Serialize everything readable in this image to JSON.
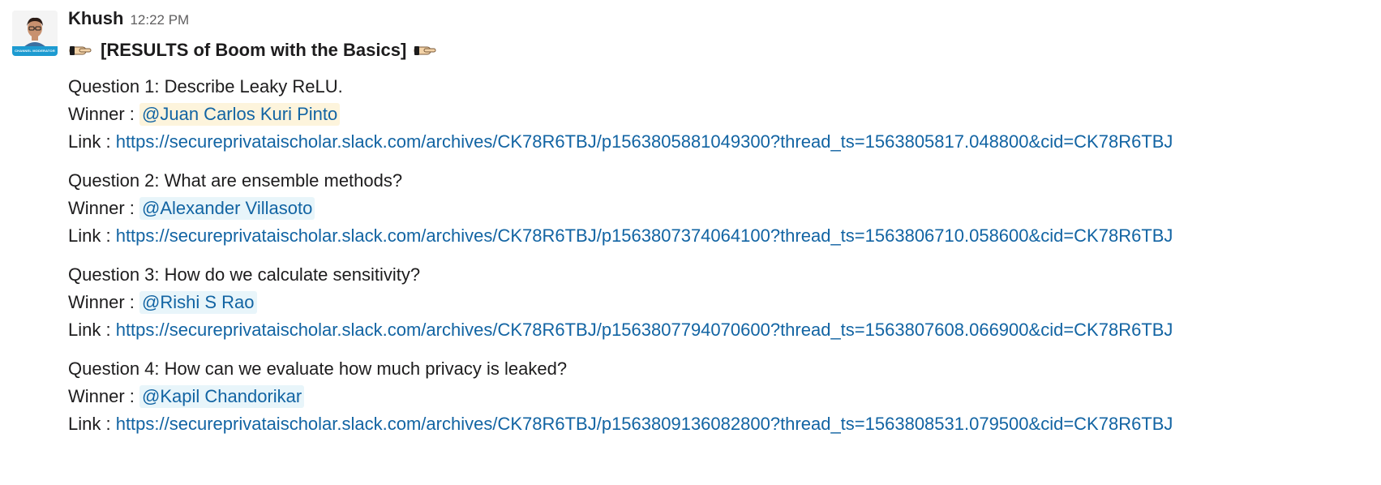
{
  "message": {
    "author": "Khush",
    "timestamp": "12:22 PM",
    "avatar_badge": "CHANNEL MODERATOR",
    "title": "[RESULTS of Boom with the Basics]",
    "title_icon": "pointing-hand-emoji",
    "colors": {
      "link": "#1264a3",
      "mention_bg": "#e8f5fa",
      "mention_self_bg": "#fdf4dc"
    },
    "questions": [
      {
        "question": "Question 1: Describe Leaky ReLU.",
        "winner_label": "Winner : ",
        "winner": "@Juan Carlos Kuri Pinto",
        "link_label": "Link : ",
        "link": "https://secureprivataischolar.slack.com/archives/CK78R6TBJ/p1563805881049300?thread_ts=1563805817.048800&cid=CK78R6TBJ"
      },
      {
        "question": "Question 2: What are ensemble methods?",
        "winner_label": "Winner : ",
        "winner": "@Alexander Villasoto",
        "link_label": "Link : ",
        "link": "https://secureprivataischolar.slack.com/archives/CK78R6TBJ/p1563807374064100?thread_ts=1563806710.058600&cid=CK78R6TBJ"
      },
      {
        "question": "Question 3: How do we calculate sensitivity?",
        "winner_label": "Winner : ",
        "winner": "@Rishi S Rao",
        "link_label": "Link : ",
        "link": "https://secureprivataischolar.slack.com/archives/CK78R6TBJ/p1563807794070600?thread_ts=1563807608.066900&cid=CK78R6TBJ"
      },
      {
        "question": "Question 4: How can we evaluate how much privacy is leaked?",
        "winner_label": "Winner : ",
        "winner": "@Kapil Chandorikar",
        "link_label": "Link : ",
        "link": "https://secureprivataischolar.slack.com/archives/CK78R6TBJ/p1563809136082800?thread_ts=1563808531.079500&cid=CK78R6TBJ"
      }
    ]
  }
}
